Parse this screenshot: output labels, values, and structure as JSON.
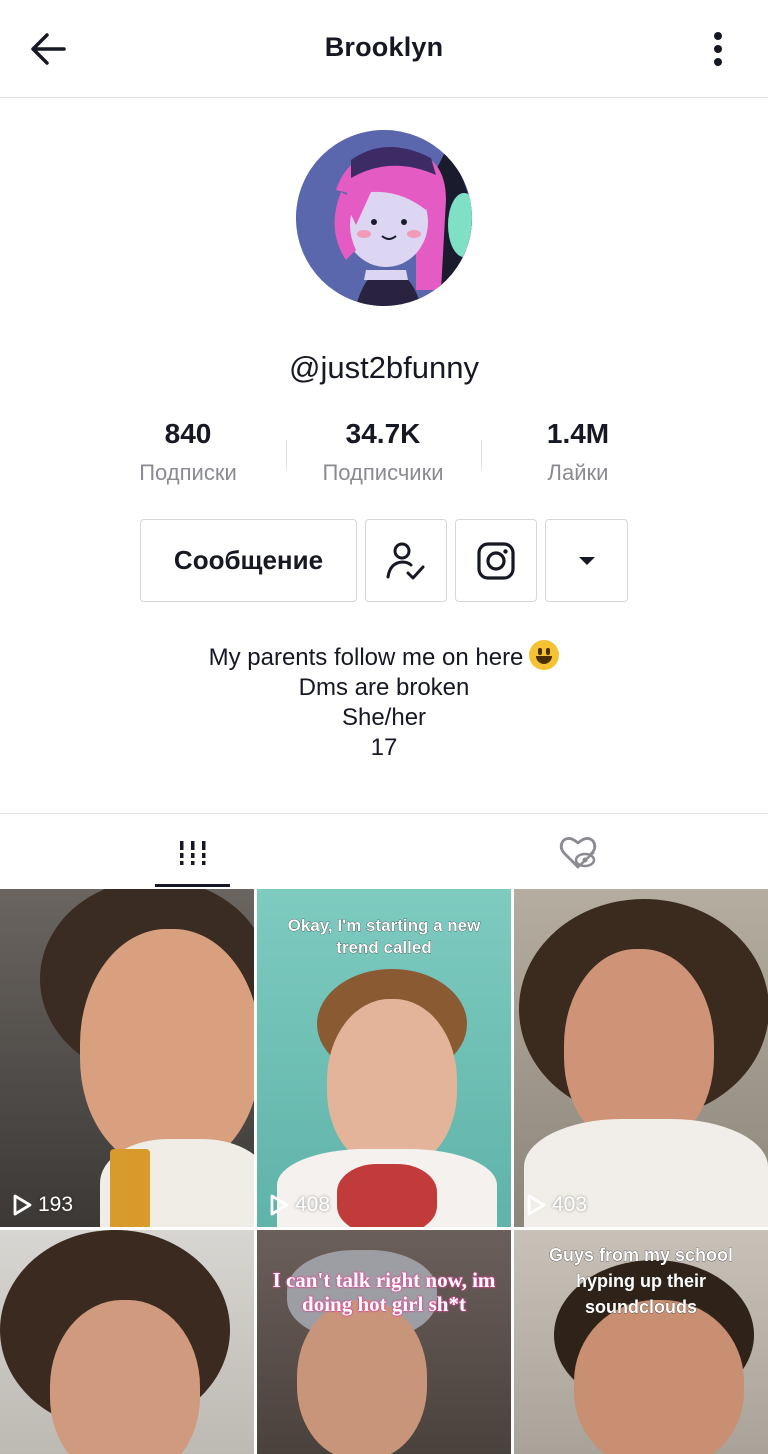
{
  "header": {
    "title": "Brooklyn"
  },
  "profile": {
    "username": "@just2bfunny"
  },
  "stats": [
    {
      "value": "840",
      "label": "Подписки"
    },
    {
      "value": "34.7K",
      "label": "Подписчики"
    },
    {
      "value": "1.4M",
      "label": "Лайки"
    }
  ],
  "actions": {
    "message_label": "Сообщение"
  },
  "bio": {
    "line1": "My parents follow me on here",
    "line2": "Dms are broken",
    "line3": "She/her",
    "line4": "17"
  },
  "videos": [
    {
      "views": "193",
      "caption": ""
    },
    {
      "views": "408",
      "caption": "Okay, I'm starting a new trend called"
    },
    {
      "views": "403",
      "caption": ""
    },
    {
      "views": "",
      "caption": ""
    },
    {
      "views": "",
      "caption": "I can't talk right now, im doing hot girl sh*t"
    },
    {
      "views": "",
      "caption": "Guys from my school hyping up their soundclouds"
    }
  ],
  "icons": {
    "back": "arrow-left-icon",
    "more": "vertical-dots-icon",
    "followed": "person-check-icon",
    "instagram": "instagram-icon",
    "dropdown": "caret-down-icon",
    "videos_tab": "grid-bars-icon",
    "liked_tab": "hidden-heart-icon",
    "play": "play-outline-icon"
  },
  "colors": {
    "text": "#161823",
    "muted": "#8a8b91",
    "border": "#e3e3e4"
  }
}
